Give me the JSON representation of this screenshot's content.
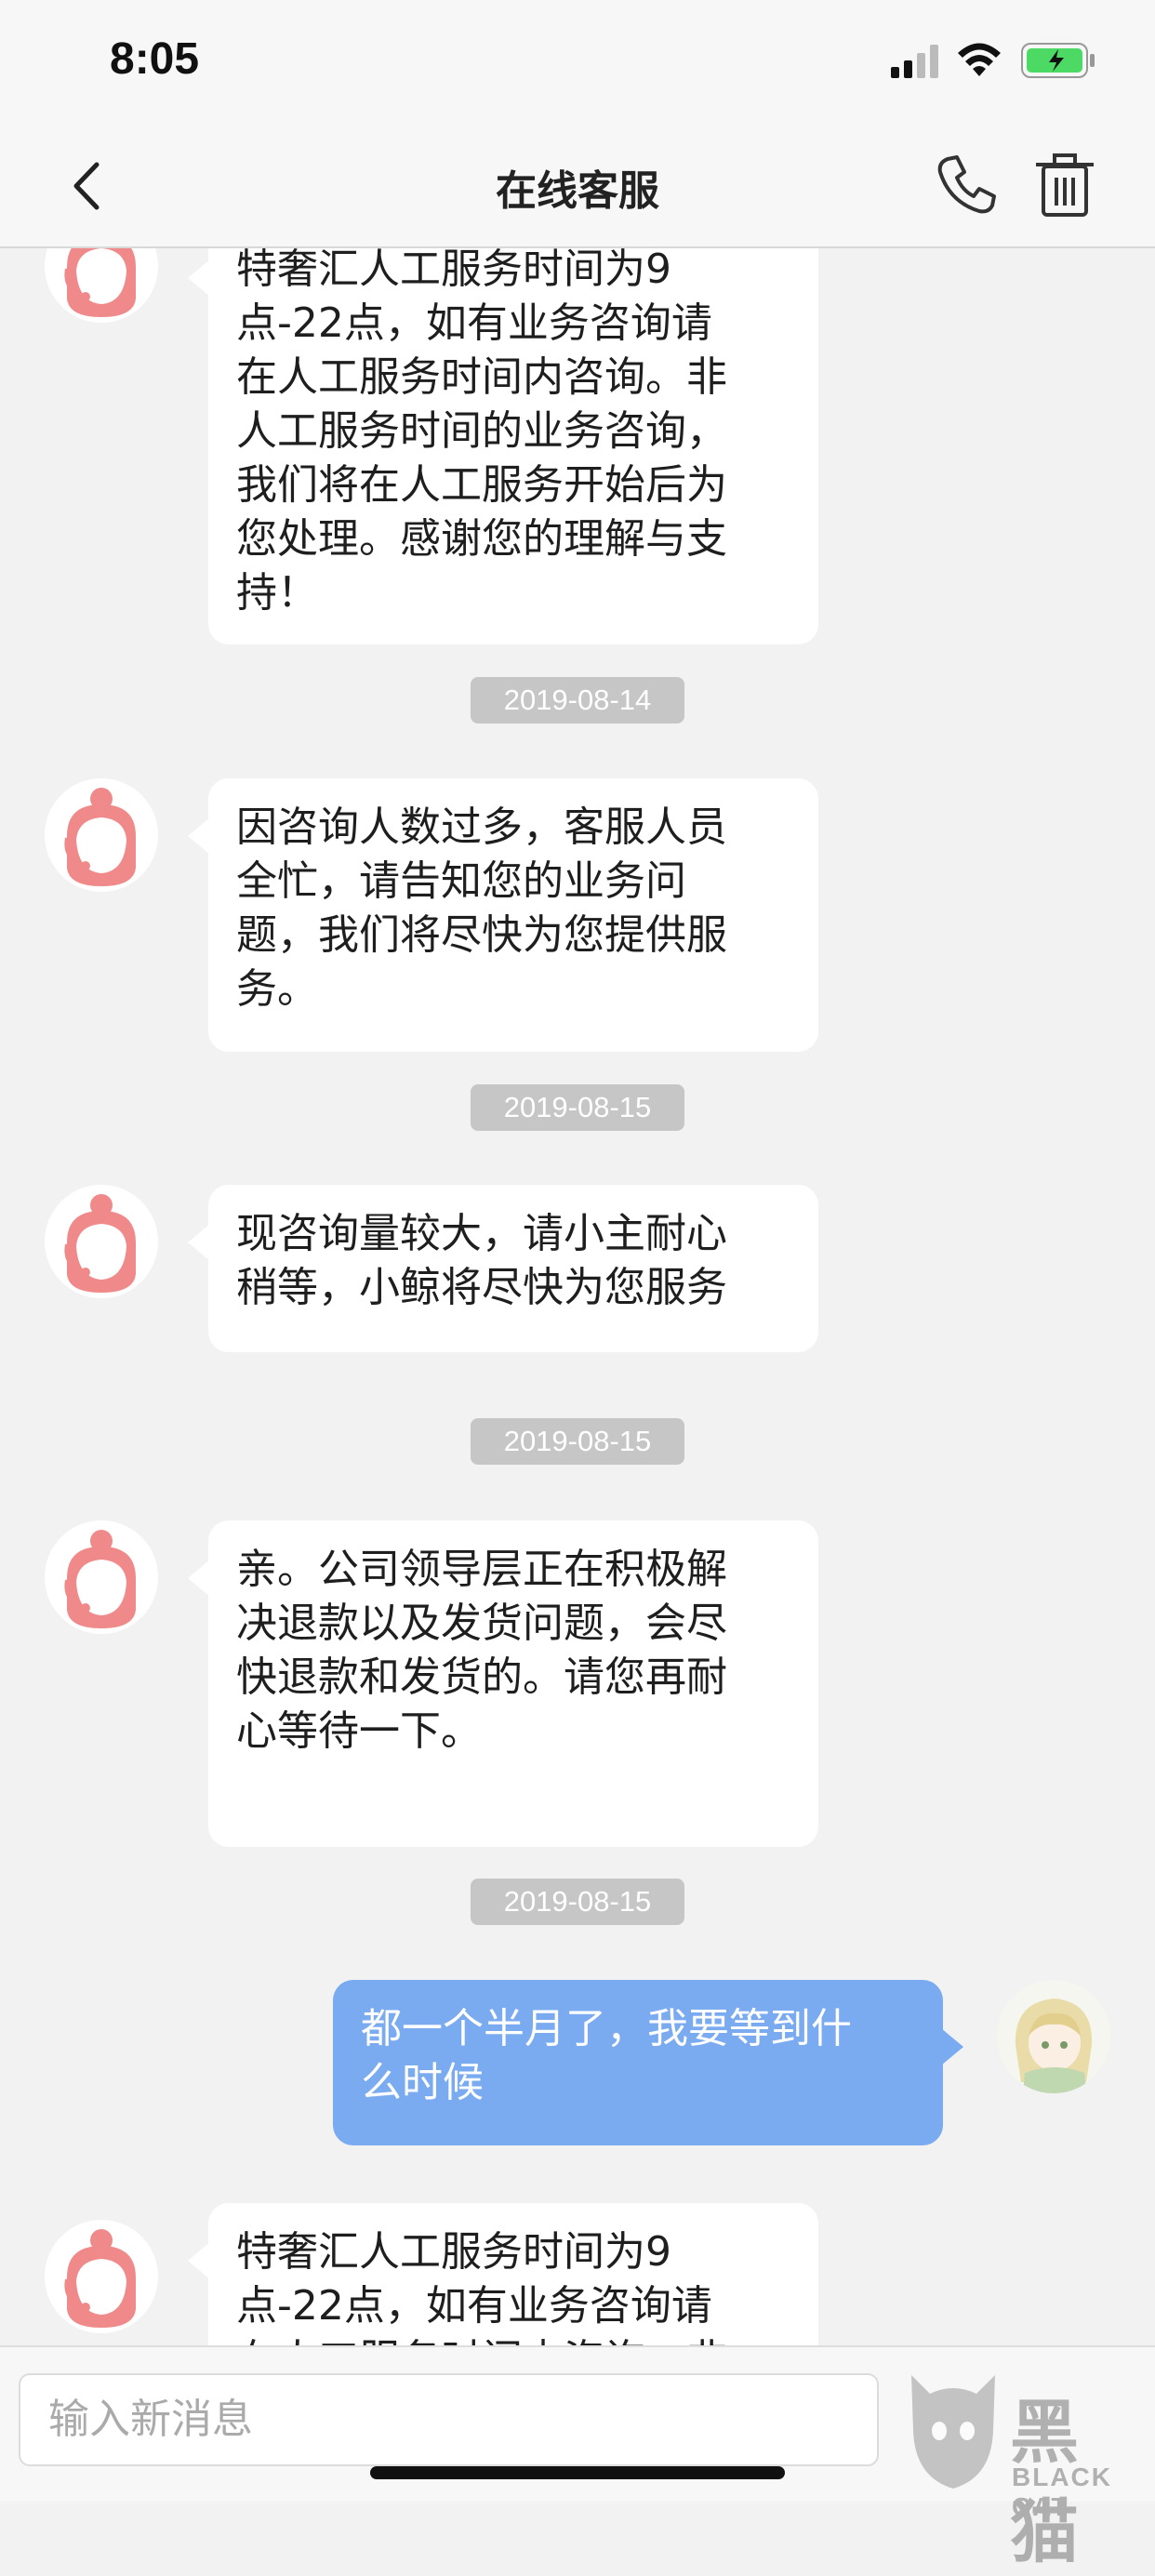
{
  "status_bar": {
    "time": "8:05"
  },
  "nav": {
    "title": "在线客服"
  },
  "messages": [
    {
      "from": "agent",
      "text": "特奢汇人工服务时间为9\n点-22点，如有业务咨询请\n在人工服务时间内咨询。非\n人工服务时间的业务咨询，\n我们将在人工服务开始后为\n您处理。感谢您的理解与支\n持！"
    },
    {
      "timestamp": "2019-08-14"
    },
    {
      "from": "agent",
      "text": "因咨询人数过多，客服人员\n全忙，请告知您的业务问\n题，我们将尽快为您提供服\n务。"
    },
    {
      "timestamp": "2019-08-15"
    },
    {
      "from": "agent",
      "text": "现咨询量较大，请小主耐心\n稍等，小鲸将尽快为您服务"
    },
    {
      "timestamp": "2019-08-15"
    },
    {
      "from": "agent",
      "text": "亲。公司领导层正在积极解\n决退款以及发货问题，会尽\n快退款和发货的。请您再耐\n心等待一下。"
    },
    {
      "timestamp": "2019-08-15"
    },
    {
      "from": "user",
      "text": "都一个半月了，我要等到什\n么时候"
    },
    {
      "from": "agent",
      "text": "特奢汇人工服务时间为9\n点-22点，如有业务咨询请\n在人工服务时间内咨询。非"
    }
  ],
  "input": {
    "placeholder": "输入新消息"
  },
  "watermark": {
    "text": "黑猫",
    "sub": "BLACK CAT"
  },
  "colors": {
    "user_bubble": "#7aaaf0",
    "agent_avatar": "#f08a8a",
    "timestamp_bg": "#c6c6c6"
  },
  "icons": [
    "back-chevron-icon",
    "phone-icon",
    "trash-icon",
    "agent-avatar-icon",
    "user-avatar-icon"
  ]
}
